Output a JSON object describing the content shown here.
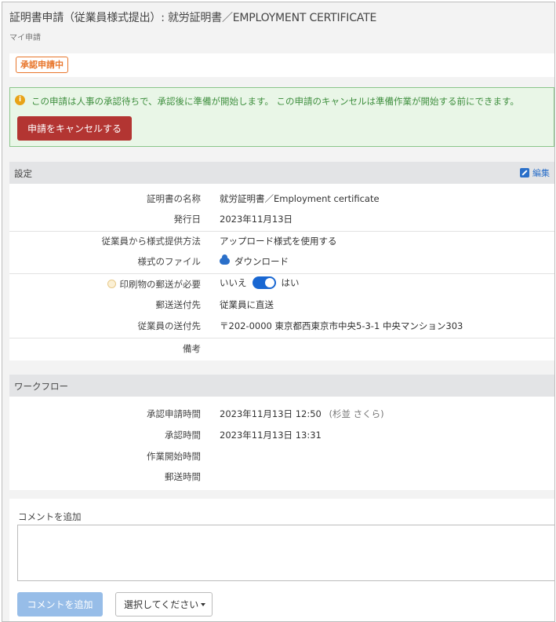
{
  "header": {
    "title": "証明書申請（従業員様式提出）: 就労証明書／EMPLOYMENT CERTIFICATE",
    "breadcrumb": "マイ申請"
  },
  "status": {
    "badge": "承認申請中",
    "color": "#e8762c"
  },
  "alert": {
    "icon": "info-icon",
    "message": "この申請は人事の承認待ちで、承認後に準備が開始します。 この申請のキャンセルは準備作業が開始する前にできます。",
    "cancel_label": "申請をキャンセルする",
    "cancel_color": "#b33532"
  },
  "settings": {
    "heading": "設定",
    "edit_label": "編集",
    "rows": [
      {
        "key": "証明書の名称",
        "value": "就労証明書／Employment certificate"
      },
      {
        "key": "発行日",
        "value": "2023年11月13日"
      },
      {
        "key": "従業員から様式提供方法",
        "value": "アップロード様式を使用する"
      },
      {
        "key": "様式のファイル",
        "value": "ダウンロード"
      },
      {
        "key": "印刷物の郵送が必要",
        "toggle_off": "いいえ",
        "toggle_on": "はい",
        "toggle_state": true
      },
      {
        "key": "郵送送付先",
        "value": "従業員に直送"
      },
      {
        "key": "従業員の送付先",
        "value": "〒202-0000 東京都西東京市中央5-3-1 中央マンション303"
      },
      {
        "key": "備考",
        "value": ""
      }
    ]
  },
  "workflow": {
    "heading": "ワークフロー",
    "rows": [
      {
        "key": "承認申請時間",
        "value": "2023年11月13日 12:50",
        "note": "(杉並 さくら)"
      },
      {
        "key": "承認時間",
        "value": "2023年11月13日 13:31"
      },
      {
        "key": "作業開始時間",
        "value": ""
      },
      {
        "key": "郵送時間",
        "value": ""
      }
    ]
  },
  "comment": {
    "label": "コメントを追加",
    "placeholder": "",
    "add_label": "コメントを追加",
    "select_label": "選択してください"
  }
}
